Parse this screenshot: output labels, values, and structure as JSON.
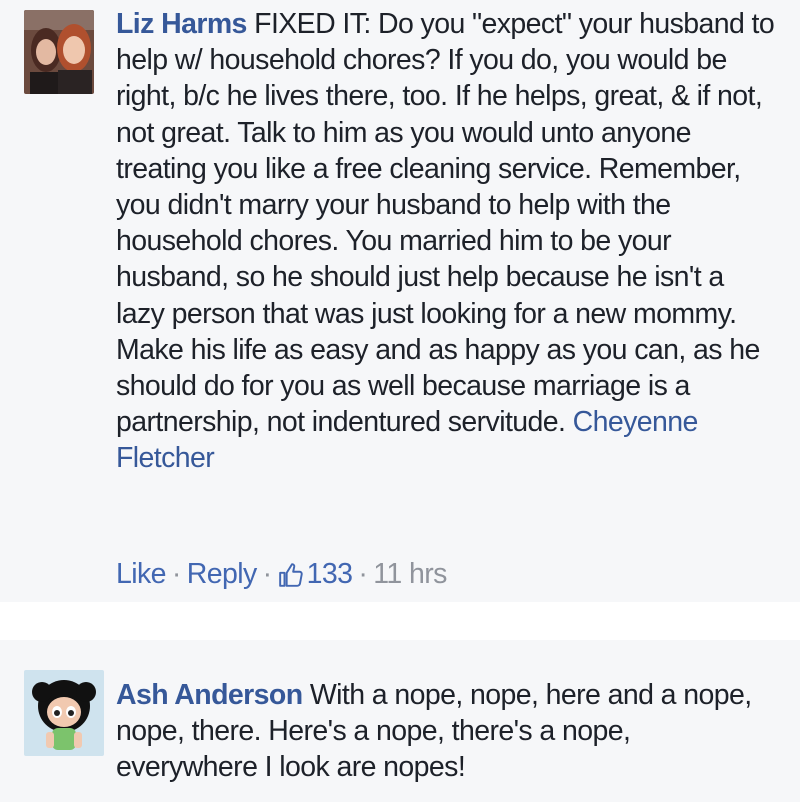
{
  "comments": [
    {
      "author": "Liz Harms",
      "body": "FIXED IT: Do you \"expect\" your husband to help w/ household chores? If you do, you would be right, b/c he lives there, too. If he helps, great, & if not, not great. Talk to him as you would unto anyone treating you like a free cleaning service. Remember, you didn't marry your husband to help with the household chores. You married him to be your husband, so he should just help because he isn't a lazy person that was just looking for a new mommy. Make his life as easy and as happy as you can, as he should do for you as well because marriage is a partnership, not indentured servitude.",
      "tag": "Cheyenne Fletcher",
      "actions": {
        "like": "Like",
        "reply": "Reply",
        "like_count": "133",
        "time": "11 hrs"
      },
      "avatar_icon": "two-women-photo-icon"
    },
    {
      "author": "Ash Anderson",
      "body": "With a nope, nope, here and a nope, nope, there. Here's a nope, there's a nope, everywhere I look are nopes!",
      "avatar_icon": "cartoon-girl-avatar-icon"
    }
  ],
  "colors": {
    "link": "#365899",
    "action": "#4267b2",
    "muted": "#90949c",
    "background": "#f6f7f9"
  }
}
